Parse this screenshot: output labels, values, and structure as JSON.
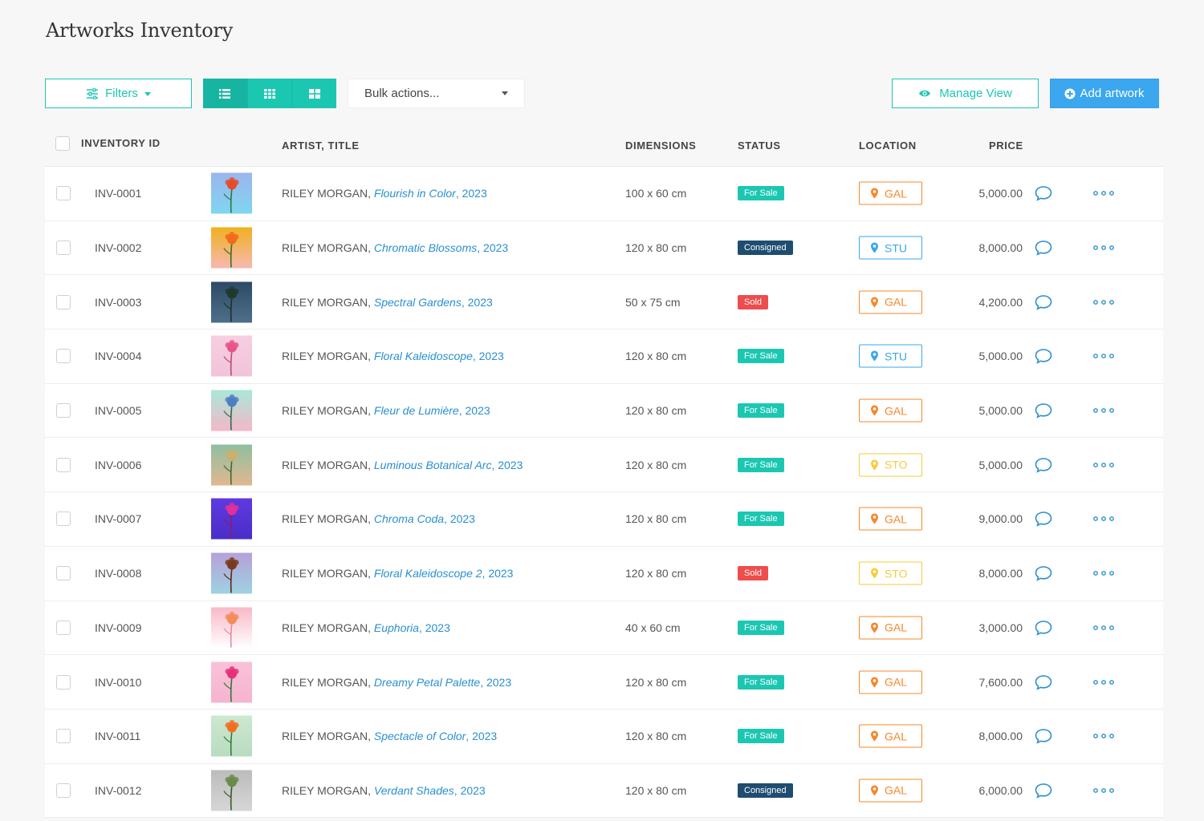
{
  "page": {
    "title": "Artworks Inventory"
  },
  "toolbar": {
    "filters_label": "Filters",
    "bulk_actions_label": "Bulk actions...",
    "manage_view_label": "Manage View",
    "add_artwork_label": "Add artwork",
    "view_modes": [
      "list-icon",
      "grid-small-icon",
      "grid-large-icon"
    ]
  },
  "colors": {
    "accent": "#1cc7b2",
    "primary": "#3aa7ee",
    "for_sale": "#1cc7b2",
    "consigned": "#1e4d70",
    "sold": "#ef4c4c",
    "loc_gal": "#f5882a",
    "loc_stu": "#3aa7ee",
    "loc_sto": "#f5cd3a"
  },
  "table": {
    "headers": {
      "inventory_id": "INVENTORY ID",
      "artist_title": "ARTIST, TITLE",
      "dimensions": "DIMENSIONS",
      "status": "STATUS",
      "location": "LOCATION",
      "price": "PRICE"
    },
    "rows": [
      {
        "id": "INV-0001",
        "artist": "RILEY MORGAN",
        "title": "Flourish in Color",
        "year": "2023",
        "dimensions": "100 x 60 cm",
        "status": "For Sale",
        "location": "GAL",
        "price": "5,000.00"
      },
      {
        "id": "INV-0002",
        "artist": "RILEY MORGAN",
        "title": "Chromatic Blossoms",
        "year": "2023",
        "dimensions": "120 x 80 cm",
        "status": "Consigned",
        "location": "STU",
        "price": "8,000.00"
      },
      {
        "id": "INV-0003",
        "artist": "RILEY MORGAN",
        "title": "Spectral Gardens",
        "year": "2023",
        "dimensions": "50 x 75 cm",
        "status": "Sold",
        "location": "GAL",
        "price": "4,200.00"
      },
      {
        "id": "INV-0004",
        "artist": "RILEY MORGAN",
        "title": "Floral Kaleidoscope",
        "year": "2023",
        "dimensions": "120 x 80 cm",
        "status": "For Sale",
        "location": "STU",
        "price": "5,000.00"
      },
      {
        "id": "INV-0005",
        "artist": "RILEY MORGAN",
        "title": "Fleur de Lumière",
        "year": "2023",
        "dimensions": "120 x 80 cm",
        "status": "For Sale",
        "location": "GAL",
        "price": "5,000.00"
      },
      {
        "id": "INV-0006",
        "artist": "RILEY MORGAN",
        "title": "Luminous Botanical Arc",
        "year": "2023",
        "dimensions": "120 x 80 cm",
        "status": "For Sale",
        "location": "STO",
        "price": "5,000.00"
      },
      {
        "id": "INV-0007",
        "artist": "RILEY MORGAN",
        "title": "Chroma Coda",
        "year": "2023",
        "dimensions": "120 x 80 cm",
        "status": "For Sale",
        "location": "GAL",
        "price": "9,000.00"
      },
      {
        "id": "INV-0008",
        "artist": "RILEY MORGAN",
        "title": "Floral Kaleidoscope 2",
        "year": "2023",
        "dimensions": "120 x 80 cm",
        "status": "Sold",
        "location": "STO",
        "price": "8,000.00"
      },
      {
        "id": "INV-0009",
        "artist": "RILEY MORGAN",
        "title": "Euphoria",
        "year": "2023",
        "dimensions": "40 x 60 cm",
        "status": "For Sale",
        "location": "GAL",
        "price": "3,000.00"
      },
      {
        "id": "INV-0010",
        "artist": "RILEY MORGAN",
        "title": "Dreamy Petal Palette",
        "year": "2023",
        "dimensions": "120 x 80 cm",
        "status": "For Sale",
        "location": "GAL",
        "price": "7,600.00"
      },
      {
        "id": "INV-0011",
        "artist": "RILEY MORGAN",
        "title": "Spectacle of Color",
        "year": "2023",
        "dimensions": "120 x 80 cm",
        "status": "For Sale",
        "location": "GAL",
        "price": "8,000.00"
      },
      {
        "id": "INV-0012",
        "artist": "RILEY MORGAN",
        "title": "Verdant Shades",
        "year": "2023",
        "dimensions": "120 x 80 cm",
        "status": "Consigned",
        "location": "GAL",
        "price": "6,000.00"
      }
    ],
    "thumbnails": [
      {
        "bg": [
          "#9bb4f0",
          "#7fd6f0"
        ],
        "flower": "#e84b2a",
        "stem": "#2f7a3a"
      },
      {
        "bg": [
          "#f0b020",
          "#f6b9b0"
        ],
        "flower": "#f26a1c",
        "stem": "#3b6b2a"
      },
      {
        "bg": [
          "#2c4a66",
          "#4e6f8a"
        ],
        "flower": "#1f3a2c",
        "stem": "#1d3326"
      },
      {
        "bg": [
          "#f6cfe0",
          "#f2c3da"
        ],
        "flower": "#e8548a",
        "stem": "#b54d73"
      },
      {
        "bg": [
          "#a9e8d8",
          "#f4b7c8"
        ],
        "flower": "#4f7ec2",
        "stem": "#2e6c4a"
      },
      {
        "bg": [
          "#8fbfa0",
          "#e0b890"
        ],
        "flower": "#c9b070",
        "stem": "#3f6a3a"
      },
      {
        "bg": [
          "#5e3ae0",
          "#4a2dc8"
        ],
        "flower": "#e0309a",
        "stem": "#8a1f6a"
      },
      {
        "bg": [
          "#b6a0d8",
          "#9ed2e2"
        ],
        "flower": "#7a3a1c",
        "stem": "#5a2a16"
      },
      {
        "bg": [
          "#f8b8c8",
          "#ffffff"
        ],
        "flower": "#f38b5a",
        "stem": "#e88aa0"
      },
      {
        "bg": [
          "#f8c2d8",
          "#f6b4cf"
        ],
        "flower": "#e8307a",
        "stem": "#2a7a3a"
      },
      {
        "bg": [
          "#cde8d0",
          "#b8dcc0"
        ],
        "flower": "#f07020",
        "stem": "#3a7a3a"
      },
      {
        "bg": [
          "#bcbcbc",
          "#d6d6d6"
        ],
        "flower": "#6a8a4a",
        "stem": "#3a5a2a"
      }
    ]
  }
}
